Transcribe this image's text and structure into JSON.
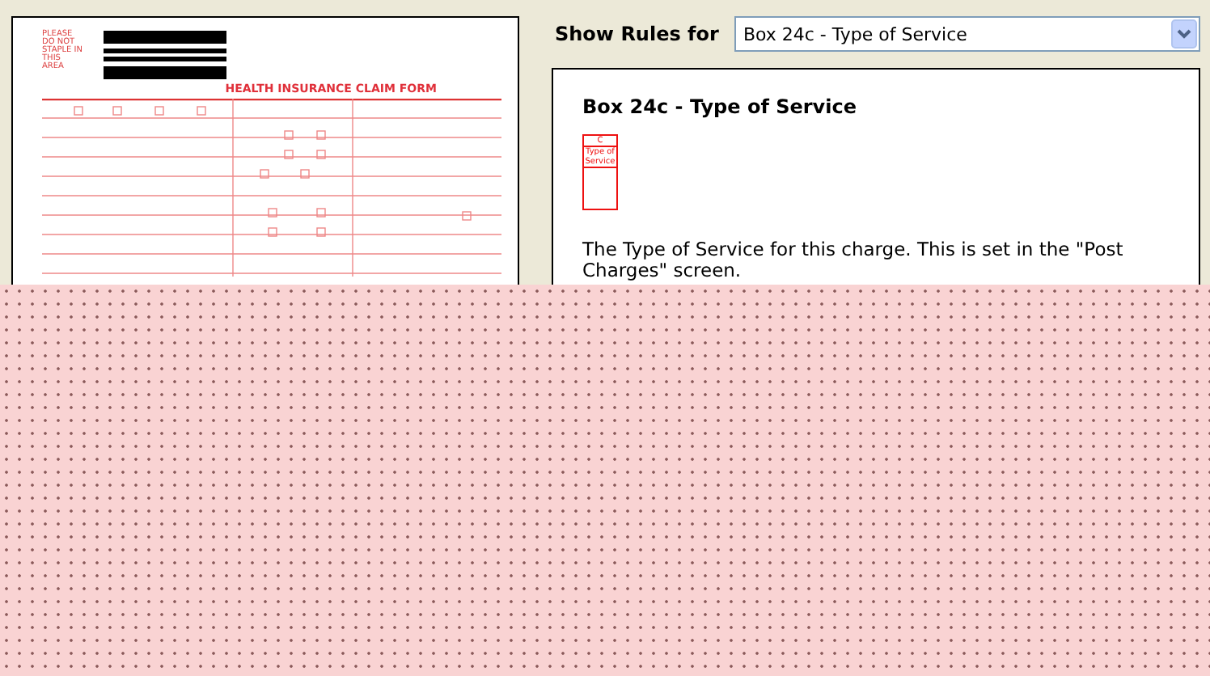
{
  "form_preview": {
    "notice": "PLEASE DO NOT STAPLE IN THIS AREA",
    "title": "HEALTH INSURANCE CLAIM FORM"
  },
  "rule_selector": {
    "label": "Show Rules for",
    "value": "Box 24c - Type of Service"
  },
  "rule_panel": {
    "heading": "Box 24c - Type of Service",
    "box_sample": {
      "letter": "C",
      "caption": "Type of Service"
    },
    "description": "The Type of Service for this charge.  This is set in the \"Post Charges\" screen."
  }
}
